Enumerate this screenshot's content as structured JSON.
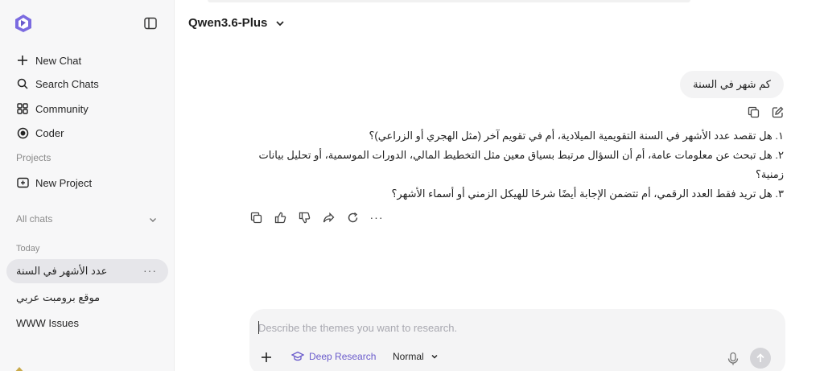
{
  "sidebar": {
    "new_chat": "New Chat",
    "search_chats": "Search Chats",
    "community": "Community",
    "coder": "Coder",
    "projects_label": "Projects",
    "new_project": "New Project",
    "all_chats_label": "All chats",
    "today_label": "Today",
    "chats": [
      {
        "title": "عدد الأشهر في السنة",
        "active": true
      },
      {
        "title": "موقع برومبت عربي",
        "active": false
      },
      {
        "title": "WWW Issues",
        "active": false
      }
    ],
    "more_glyph": "···"
  },
  "header": {
    "model_name": "Qwen3.6-Plus"
  },
  "conversation": {
    "user_message": "كم شهر في السنة",
    "assistant_lines": [
      "١. هل تقصد عدد الأشهر في السنة التقويمية الميلادية، أم في تقويم آخر (مثل الهجري أو الزراعي)؟",
      "٢. هل تبحث عن معلومات عامة، أم أن السؤال مرتبط بسياق معين مثل التخطيط المالي، الدورات الموسمية، أو تحليل بيانات زمنية؟",
      "٣. هل تريد فقط العدد الرقمي، أم تتضمن الإجابة أيضًا شرحًا للهيكل الزمني أو أسماء الأشهر؟"
    ],
    "more_glyph": "···"
  },
  "composer": {
    "placeholder": "Describe the themes you want to research.",
    "value": "",
    "deep_research_label": "Deep Research",
    "mode_label": "Normal"
  },
  "colors": {
    "accent": "#6b5ccc",
    "sidebar_bg": "#f7f7f8",
    "active_chat_bg": "#e6e6ea",
    "composer_bg": "#f4f4f5"
  },
  "icons": {
    "logo": "qwen-logo-icon",
    "sidebar_toggle": "sidebar-toggle-icon",
    "new_chat": "plus-icon",
    "search": "search-icon",
    "community": "grid-icon",
    "coder": "target-icon",
    "new_project": "folder-plus-icon",
    "copy": "copy-icon",
    "edit": "edit-icon",
    "like": "thumbs-up-icon",
    "dislike": "thumbs-down-icon",
    "share": "share-icon",
    "regenerate": "refresh-icon",
    "mic": "mic-icon",
    "send": "arrow-up-icon"
  }
}
